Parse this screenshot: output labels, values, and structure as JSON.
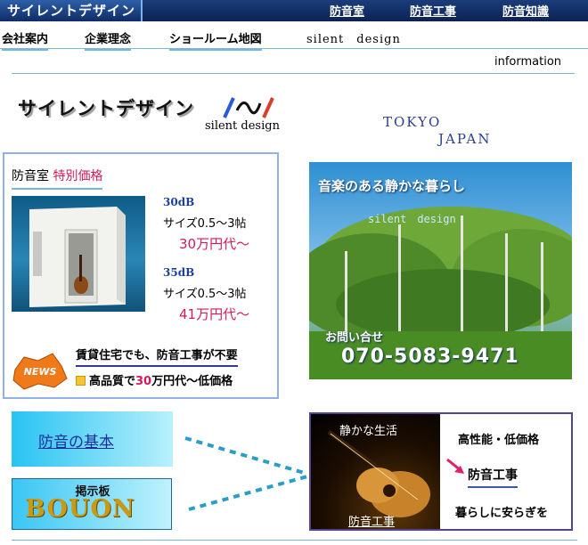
{
  "header": {
    "brand": "サイレントデザイン",
    "nav": [
      "防音室",
      "防音工事",
      "防音知識"
    ]
  },
  "subnav": {
    "items": [
      "会社案内",
      "企業理念",
      "ショールーム地図",
      "silent　design"
    ]
  },
  "info_link": "information",
  "logo": {
    "title": "サイレントデザイン",
    "subtitle": "silent design"
  },
  "location": {
    "city": "TOKYO",
    "country": "JAPAN"
  },
  "promo": {
    "title": "防音室",
    "title_highlight": "特別価格",
    "specs": [
      {
        "db": "30dB",
        "size": "サイズ0.5～3帖",
        "price": "30万円代～"
      },
      {
        "db": "35dB",
        "size": "サイズ0.5～3帖",
        "price": "41万円代～"
      }
    ],
    "news_badge": "NEWS",
    "renting_text": "賃貸住宅でも、防音工事が不要",
    "quality_pre": "高品質で",
    "quality_num": "30",
    "quality_post": "万円代～低価格"
  },
  "banner": {
    "tagline": "音楽のある静かな暮らし",
    "watermark": "silent　design",
    "contact_label": "お問い合せ",
    "phone": "070-5083-9471"
  },
  "buttons": {
    "basics": "防音の基本",
    "board_label": "掲示板",
    "board_logo": "BOUON"
  },
  "guitar_panel": {
    "quiet_life": "静かな生活",
    "work_caption": "防音工事",
    "feature": "高性能・低価格",
    "link": "防音工事",
    "slogan": "暮らしに安らぎを"
  },
  "colors": {
    "nav_bg": "#0c2254",
    "accent_red": "#d01a5a",
    "link_blue": "#1a2f9a",
    "divider": "#7ab6d8"
  }
}
